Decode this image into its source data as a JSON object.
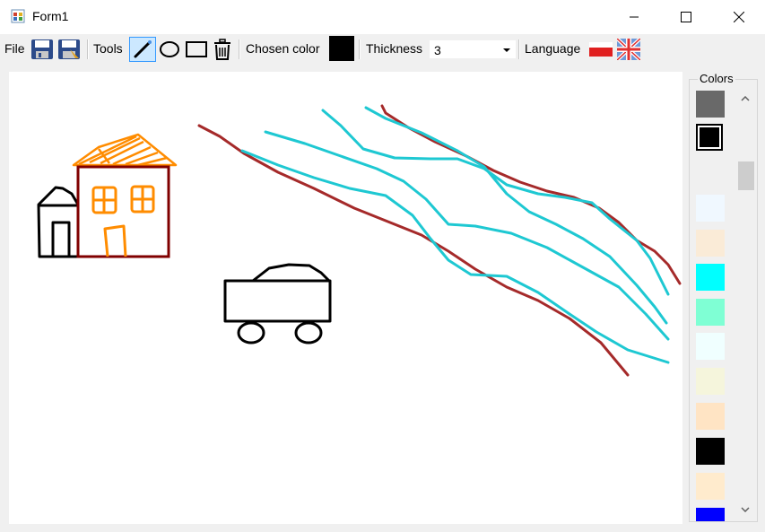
{
  "window": {
    "title": "Form1"
  },
  "menu": {
    "file": "File"
  },
  "toolbar": {
    "tools_label": "Tools",
    "chosen_color_label": "Chosen color",
    "chosen_color": "#000000",
    "thickness_label": "Thickness",
    "thickness_value": "3",
    "language_label": "Language"
  },
  "colors_panel": {
    "label": "Colors",
    "swatches": [
      "#696969",
      "#000000",
      "#f0f8ff",
      "#faebd7",
      "#00ffff",
      "#7fffd4",
      "#f0ffff",
      "#f5f5dc",
      "#ffe4c4",
      "#000000",
      "#ffebcd",
      "#0000ff"
    ]
  },
  "colors": {
    "cyan": "#1ec8d2",
    "dark_red": "#a52a2a",
    "orange": "#ff8c00",
    "maroon": "#800000",
    "black": "#000000"
  }
}
